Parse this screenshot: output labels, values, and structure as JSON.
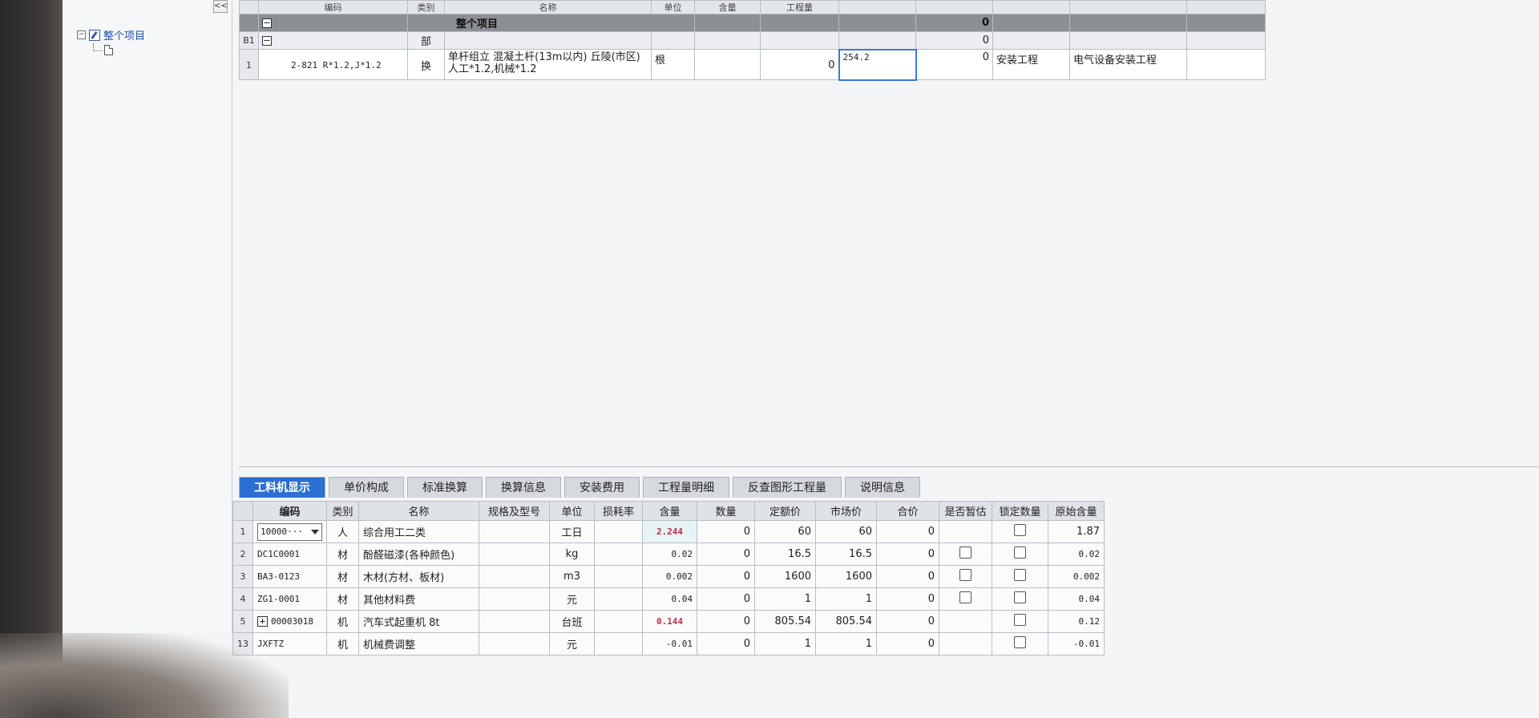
{
  "top_grid": {
    "headers": [
      "编码",
      "类别",
      "名称",
      "单位",
      "含量",
      "工程量"
    ],
    "group_row": {
      "label": "整个项目",
      "value": "0"
    },
    "sub_row": {
      "rownum": "B1",
      "type": "部",
      "value": "0"
    },
    "item_row": {
      "rownum": "1",
      "code": "2-821 R*1.2,J*1.2",
      "type": "换",
      "name": "单杆组立 混凝土杆(13m以内) 丘陵(市区) 人工*1.2,机械*1.2",
      "unit": "根",
      "qty": "0",
      "editing_value": "254.2",
      "total": "0",
      "specialty": "安装工程",
      "category": "电气设备安装工程"
    }
  },
  "tree": {
    "root_label": "整个项目",
    "collapse_label": "<<"
  },
  "tabs": [
    {
      "label": "工料机显示",
      "active": true
    },
    {
      "label": "单价构成",
      "active": false
    },
    {
      "label": "标准换算",
      "active": false
    },
    {
      "label": "换算信息",
      "active": false
    },
    {
      "label": "安装费用",
      "active": false
    },
    {
      "label": "工程量明细",
      "active": false
    },
    {
      "label": "反查图形工程量",
      "active": false
    },
    {
      "label": "说明信息",
      "active": false
    }
  ],
  "bottom_grid": {
    "headers": [
      "编码",
      "类别",
      "名称",
      "规格及型号",
      "单位",
      "损耗率",
      "含量",
      "数量",
      "定额价",
      "市场价",
      "合价",
      "是否暂估",
      "锁定数量",
      "原始含量"
    ],
    "rows": [
      {
        "rownum": "1",
        "code": "10000···",
        "type": "人",
        "name": "综合用工二类",
        "spec": "",
        "unit": "工日",
        "loss": "",
        "content": "2.244",
        "qty": "0",
        "quota_price": "60",
        "market_price": "60",
        "total": "0",
        "estimate": false,
        "lock": true,
        "orig": "1.87"
      },
      {
        "rownum": "2",
        "code": "DC1C0001",
        "type": "材",
        "name": "酚醛磁漆(各种颜色)",
        "spec": "",
        "unit": "kg",
        "loss": "",
        "content": "0.02",
        "qty": "0",
        "quota_price": "16.5",
        "market_price": "16.5",
        "total": "0",
        "estimate": true,
        "lock": true,
        "orig": "0.02"
      },
      {
        "rownum": "3",
        "code": "BA3-0123",
        "type": "材",
        "name": "木材(方材、板材)",
        "spec": "",
        "unit": "m3",
        "loss": "",
        "content": "0.002",
        "qty": "0",
        "quota_price": "1600",
        "market_price": "1600",
        "total": "0",
        "estimate": true,
        "lock": true,
        "orig": "0.002"
      },
      {
        "rownum": "4",
        "code": "ZG1-0001",
        "type": "材",
        "name": "其他材料费",
        "spec": "",
        "unit": "元",
        "loss": "",
        "content": "0.04",
        "qty": "0",
        "quota_price": "1",
        "market_price": "1",
        "total": "0",
        "estimate": true,
        "lock": true,
        "orig": "0.04"
      },
      {
        "rownum": "5",
        "code": "00003018",
        "type": "机",
        "name": "汽车式起重机 8t",
        "spec": "",
        "unit": "台班",
        "loss": "",
        "content": "0.144",
        "qty": "0",
        "quota_price": "805.54",
        "market_price": "805.54",
        "total": "0",
        "estimate": false,
        "lock": true,
        "orig": "0.12"
      },
      {
        "rownum": "13",
        "code": "JXFTZ",
        "type": "机",
        "name": "机械费调整",
        "spec": "",
        "unit": "元",
        "loss": "",
        "content": "-0.01",
        "qty": "0",
        "quota_price": "1",
        "market_price": "1",
        "total": "0",
        "estimate": false,
        "lock": true,
        "orig": "-0.01"
      }
    ]
  }
}
